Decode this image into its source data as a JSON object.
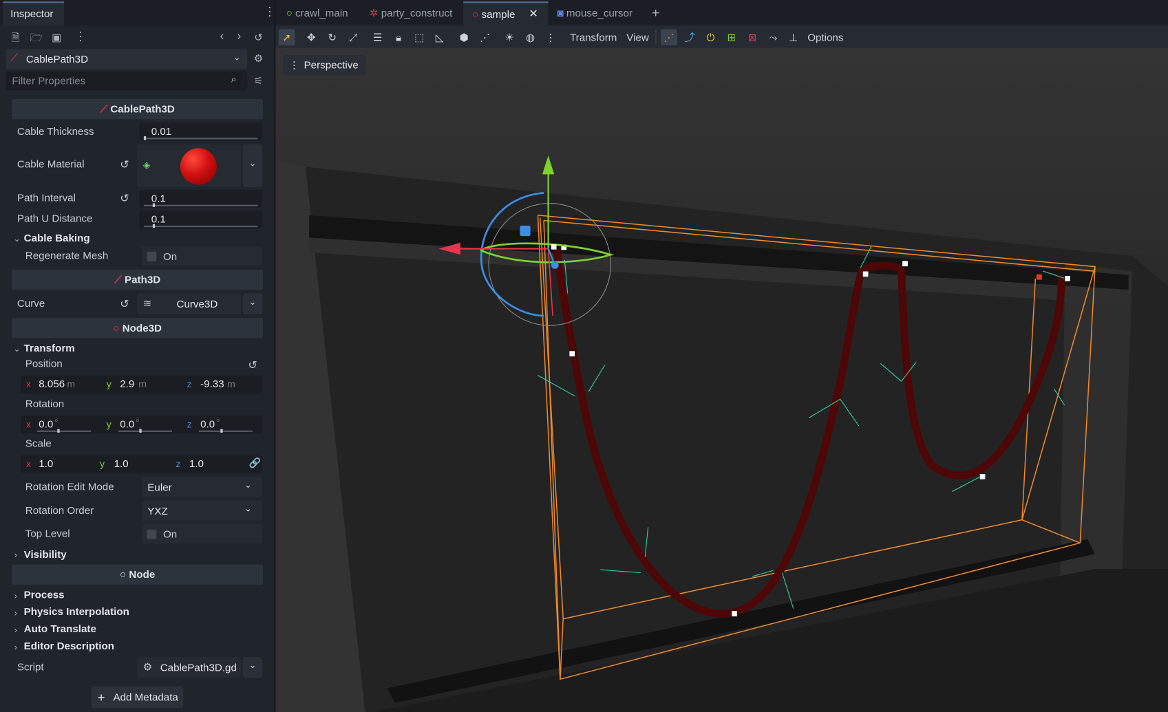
{
  "inspector": {
    "tab_label": "Inspector",
    "node_selector": "CablePath3D",
    "filter_placeholder": "Filter Properties",
    "sections": {
      "cablepath3d": "CablePath3D",
      "path3d": "Path3D",
      "node3d": "Node3D",
      "node": "Node"
    },
    "cable_thickness": {
      "label": "Cable Thickness",
      "value": "0.01"
    },
    "cable_material": {
      "label": "Cable Material"
    },
    "path_interval": {
      "label": "Path Interval",
      "value": "0.1"
    },
    "path_u_distance": {
      "label": "Path U Distance",
      "value": "0.1"
    },
    "cable_baking": {
      "label": "Cable Baking"
    },
    "regenerate_mesh": {
      "label": "Regenerate Mesh",
      "value": "On"
    },
    "curve": {
      "label": "Curve",
      "value": "Curve3D"
    },
    "transform": {
      "label": "Transform"
    },
    "position": {
      "label": "Position",
      "x": "8.056",
      "y": "2.9",
      "z": "-9.33",
      "unit": "m"
    },
    "rotation": {
      "label": "Rotation",
      "x": "0.0",
      "y": "0.0",
      "z": "0.0",
      "unit": "°"
    },
    "scale": {
      "label": "Scale",
      "x": "1.0",
      "y": "1.0",
      "z": "1.0"
    },
    "rotation_edit_mode": {
      "label": "Rotation Edit Mode",
      "value": "Euler"
    },
    "rotation_order": {
      "label": "Rotation Order",
      "value": "YXZ"
    },
    "top_level": {
      "label": "Top Level",
      "value": "On"
    },
    "visibility": {
      "label": "Visibility"
    },
    "process": {
      "label": "Process"
    },
    "physics_interpolation": {
      "label": "Physics Interpolation"
    },
    "auto_translate": {
      "label": "Auto Translate"
    },
    "editor_description": {
      "label": "Editor Description"
    },
    "script": {
      "label": "Script",
      "value": "CablePath3D.gd"
    },
    "add_metadata": "Add Metadata",
    "axis_labels": {
      "x": "x",
      "y": "y",
      "z": "z"
    }
  },
  "scene_tabs": [
    {
      "label": "crawl_main",
      "icon": "node3d-icon",
      "active": false
    },
    {
      "label": "party_construct",
      "icon": "tree-icon",
      "active": false
    },
    {
      "label": "sample",
      "icon": "node3d-icon",
      "active": true
    },
    {
      "label": "mouse_cursor",
      "icon": "godot-icon",
      "active": false
    }
  ],
  "toolbar": {
    "transform_menu": "Transform",
    "view_menu": "View",
    "options_menu": "Options"
  },
  "viewport": {
    "perspective_label": "Perspective"
  },
  "colors": {
    "accent": "#4d6a94",
    "selection_orange": "#f08a2c",
    "cable": "#4e0606",
    "gizmo_x": "#e8344a",
    "gizmo_y": "#7fd12c",
    "gizmo_z": "#3a8ee8"
  }
}
